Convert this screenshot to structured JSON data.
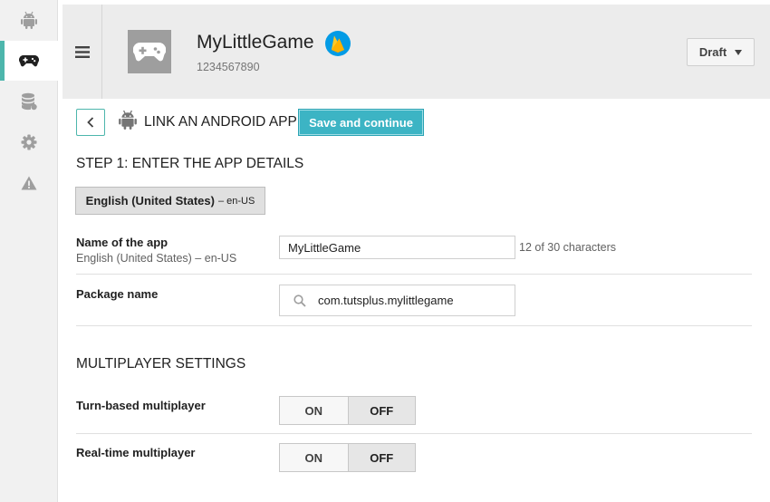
{
  "sidebar": {
    "items": [
      {
        "icon": "android-icon",
        "active": false
      },
      {
        "icon": "gamepad-icon",
        "active": true
      },
      {
        "icon": "database-icon",
        "active": false
      },
      {
        "icon": "gear-icon",
        "active": false
      },
      {
        "icon": "warning-icon",
        "active": false
      }
    ]
  },
  "header": {
    "app_name": "MyLittleGame",
    "app_id": "1234567890",
    "status_dropdown": "Draft",
    "badge_icon": "firebase-icon"
  },
  "page": {
    "link_title": "LINK AN ANDROID APP",
    "save_button": "Save and continue",
    "step_title": "STEP 1: ENTER THE APP DETAILS",
    "language_chip": {
      "language": "English (United States)",
      "code": "– en-US"
    }
  },
  "form": {
    "app_name_label": "Name of the app",
    "app_name_sublabel": "English (United States) – en-US",
    "app_name_value": "MyLittleGame",
    "char_count": "12 of 30 characters",
    "package_label": "Package name",
    "package_value": "com.tutsplus.mylittlegame"
  },
  "multiplayer": {
    "title": "MULTIPLAYER SETTINGS",
    "settings": [
      {
        "label": "Turn-based multiplayer",
        "on": "ON",
        "off": "OFF",
        "selected": "OFF"
      },
      {
        "label": "Real-time multiplayer",
        "on": "ON",
        "off": "OFF",
        "selected": "OFF"
      }
    ]
  },
  "colors": {
    "accent": "#3cb4c4",
    "active_indicator": "#4db6ac",
    "sidebar_bg": "#f1f1f1",
    "header_bg": "#ececec"
  }
}
